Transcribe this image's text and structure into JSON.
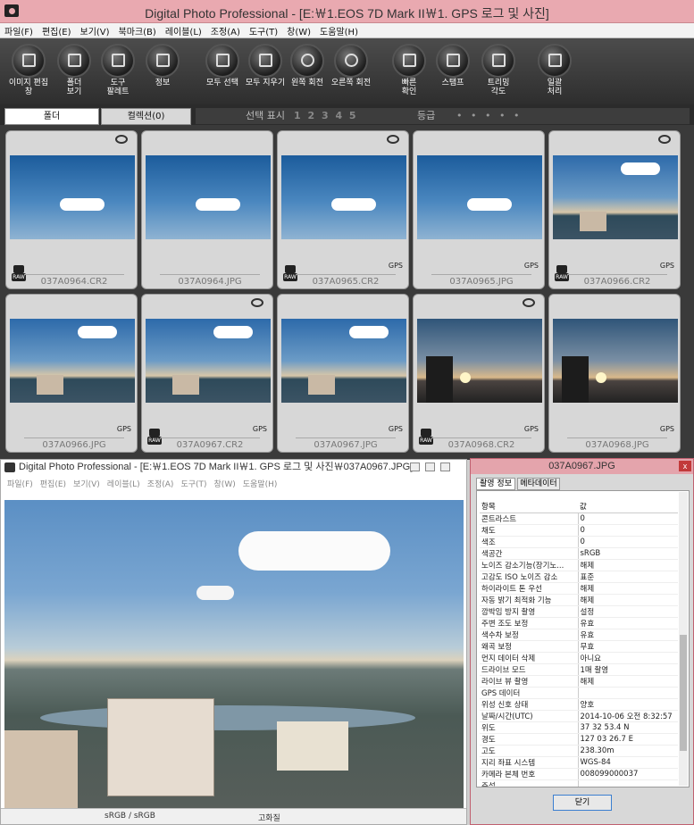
{
  "main": {
    "title": "Digital Photo Professional - [E:￦1.EOS 7D Mark II￦1. GPS 로그 및 사진]",
    "menu": [
      "파일(F)",
      "편집(E)",
      "보기(V)",
      "북마크(B)",
      "레이블(L)",
      "조정(A)",
      "도구(T)",
      "창(W)",
      "도움말(H)"
    ],
    "toolbar": [
      {
        "label": "이미지 편집\n창",
        "icon": "edit-image-icon"
      },
      {
        "label": "폴더\n보기",
        "icon": "folder-view-icon"
      },
      {
        "label": "도구\n팔레트",
        "icon": "tool-palette-icon"
      },
      {
        "label": "정보",
        "icon": "info-icon"
      },
      {
        "label": "모두 선택",
        "icon": "select-all-icon"
      },
      {
        "label": "모두 지우기",
        "icon": "clear-all-icon"
      },
      {
        "label": "왼쪽 회전",
        "icon": "rotate-left-icon"
      },
      {
        "label": "오른쪽 회전",
        "icon": "rotate-right-icon"
      },
      {
        "label": "빠른\n확인",
        "icon": "quick-check-icon"
      },
      {
        "label": "스탬프",
        "icon": "stamp-icon"
      },
      {
        "label": "트리밍\n각도",
        "icon": "trim-angle-icon"
      },
      {
        "label": "일괄\n처리",
        "icon": "batch-process-icon"
      }
    ],
    "tabs": {
      "folder": "폴더",
      "collection": "컬렉션(0)"
    },
    "ratebar": {
      "select_label": "선택 표시",
      "numbers": "1 2 3 4 5",
      "grade_label": "등급",
      "dots": "• • • • •"
    },
    "thumbnails": [
      {
        "name": "037A0964.CR2",
        "raw": true,
        "gps": false,
        "rot": true,
        "scene": "sky"
      },
      {
        "name": "037A0964.JPG",
        "raw": false,
        "gps": false,
        "rot": false,
        "scene": "sky"
      },
      {
        "name": "037A0965.CR2",
        "raw": true,
        "gps": true,
        "rot": true,
        "scene": "sky"
      },
      {
        "name": "037A0965.JPG",
        "raw": false,
        "gps": true,
        "rot": false,
        "scene": "sky"
      },
      {
        "name": "037A0966.CR2",
        "raw": true,
        "gps": true,
        "rot": true,
        "scene": "city"
      },
      {
        "name": "037A0966.JPG",
        "raw": false,
        "gps": true,
        "rot": false,
        "scene": "city"
      },
      {
        "name": "037A0967.CR2",
        "raw": true,
        "gps": true,
        "rot": true,
        "scene": "city"
      },
      {
        "name": "037A0967.JPG",
        "raw": false,
        "gps": true,
        "rot": false,
        "scene": "city"
      },
      {
        "name": "037A0968.CR2",
        "raw": true,
        "gps": true,
        "rot": true,
        "scene": "sunset"
      },
      {
        "name": "037A0968.JPG",
        "raw": false,
        "gps": true,
        "rot": false,
        "scene": "sunset"
      }
    ],
    "gps_label": "GPS",
    "raw_label": "RAW"
  },
  "viewer": {
    "title": "Digital Photo Professional - [E:￦1.EOS 7D Mark II￦1. GPS 로그 및 사진￦037A0967.JPG]",
    "menu": [
      "파일(F)",
      "편집(E)",
      "보기(V)",
      "레이블(L)",
      "조정(A)",
      "도구(T)",
      "창(W)",
      "도움말(H)"
    ],
    "status_color": "sRGB / sRGB",
    "status_quality": "고화질"
  },
  "info": {
    "title": "037A0967.JPG",
    "close_x": "x",
    "tab_shoot": "촬영 정보",
    "tab_meta": "메타데이터",
    "header_item": "항목",
    "header_value": "값",
    "rows": [
      [
        "콘트라스트",
        "0"
      ],
      [
        "채도",
        "0"
      ],
      [
        "색조",
        "0"
      ],
      [
        "색공간",
        "sRGB"
      ],
      [
        "노이즈 감소기능(장기노...",
        "해제"
      ],
      [
        "고감도 ISO 노이즈 감소",
        "표준"
      ],
      [
        "하이라이트 톤 우선",
        "해제"
      ],
      [
        "자동 밝기 최적화 기능",
        "해제"
      ],
      [
        "깜박임 방지 촬영",
        "설정"
      ],
      [
        "주변 조도 보정",
        "유효"
      ],
      [
        "색수차 보정",
        "유효"
      ],
      [
        "왜곡 보정",
        "무효"
      ],
      [
        "먼지 데이터 삭제",
        "아니요"
      ],
      [
        "드라이브 모드",
        "1매 촬영"
      ],
      [
        "라이브 뷰 촬영",
        "해제"
      ],
      [
        "GPS 데이터",
        ""
      ],
      [
        "위성 신호 상태",
        "양호"
      ],
      [
        "날짜/시간(UTC)",
        "2014-10-06 오전 8:32:57"
      ],
      [
        "위도",
        "37 32 53.4 N"
      ],
      [
        "경도",
        "127 03 26.7 E"
      ],
      [
        "고도",
        "238.30m"
      ],
      [
        "지리 좌표 시스템",
        "WGS-84"
      ],
      [
        "카메라 본체 번호",
        "008099000037"
      ],
      [
        "주석",
        ""
      ]
    ],
    "close_button": "닫기"
  }
}
